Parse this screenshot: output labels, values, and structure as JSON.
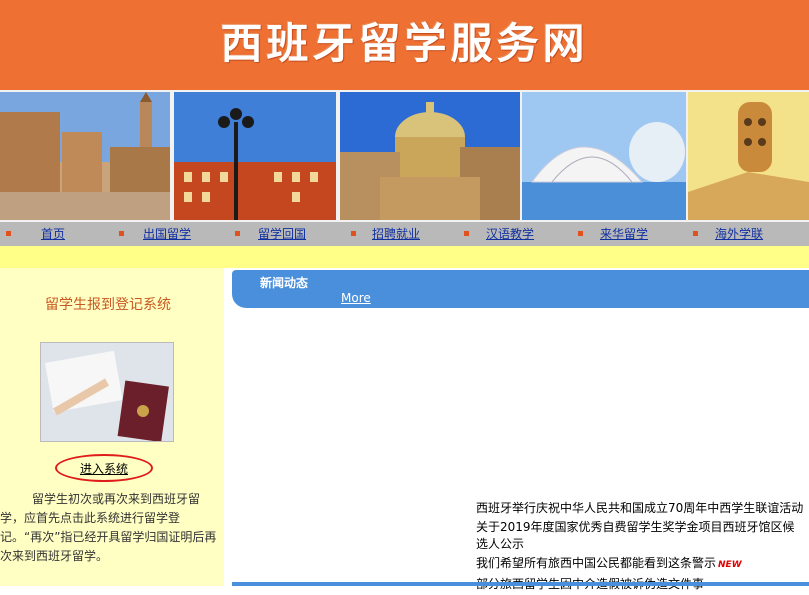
{
  "header": {
    "title": "西班牙留学服务网"
  },
  "nav": {
    "items": [
      {
        "label": "首页"
      },
      {
        "label": "出国留学"
      },
      {
        "label": "留学回国"
      },
      {
        "label": "招聘就业"
      },
      {
        "label": "汉语教学"
      },
      {
        "label": "来华留学"
      },
      {
        "label": "海外学联"
      }
    ]
  },
  "left": {
    "title": "留学生报到登记系统",
    "enter_label": "进入系统",
    "description": "留学生初次或再次来到西班牙留学，应首先点击此系统进行留学登记。“再次”指已经开具留学归国证明后再次来到西班牙留学。"
  },
  "news": {
    "title": "新闻动态",
    "more_label": "More",
    "items": [
      {
        "text": "西班牙举行庆祝中华人民共和国成立70周年中西学生联谊活动"
      },
      {
        "text": "关于2019年度国家优秀自费留学生奖学金项目西班牙馆区候选人公示"
      },
      {
        "text": "我们希望所有旅西中国公民都能看到这条警示",
        "badge": "NEW"
      },
      {
        "text": "部分旅西留学生因中介造假被诉伪造文件事"
      }
    ]
  },
  "colors": {
    "banner": "#ee7133",
    "nav": "#b9b9b9",
    "news_header": "#4a8fdc",
    "left_panel": "#ffffc4"
  }
}
